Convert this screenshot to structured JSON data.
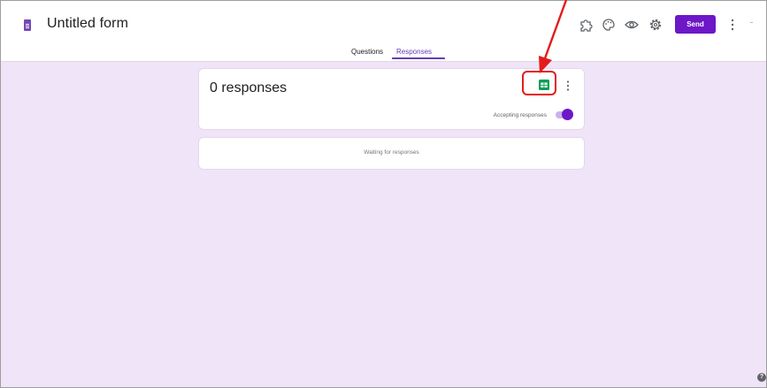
{
  "app": {
    "title": "Untitled form"
  },
  "header": {
    "send_label": "Send",
    "account_text": "....",
    "icons": [
      "addon-icon",
      "palette-icon",
      "preview-eye-icon",
      "settings-icon",
      "more-vert-icon"
    ]
  },
  "tabs": [
    {
      "label": "Questions",
      "active": false
    },
    {
      "label": "Responses",
      "active": true
    }
  ],
  "responses_card": {
    "count_label": "0 responses",
    "accepting_label": "Accepting responses",
    "accepting_on": true
  },
  "waiting_card": {
    "text": "Waiting for responses"
  },
  "help": {
    "symbol": "?"
  },
  "colors": {
    "accent": "#673ab7",
    "send_button": "#6d17c7",
    "background": "#f0e4f8",
    "sheets_green": "#0f9d58",
    "annotation_red": "#e41b1b"
  }
}
